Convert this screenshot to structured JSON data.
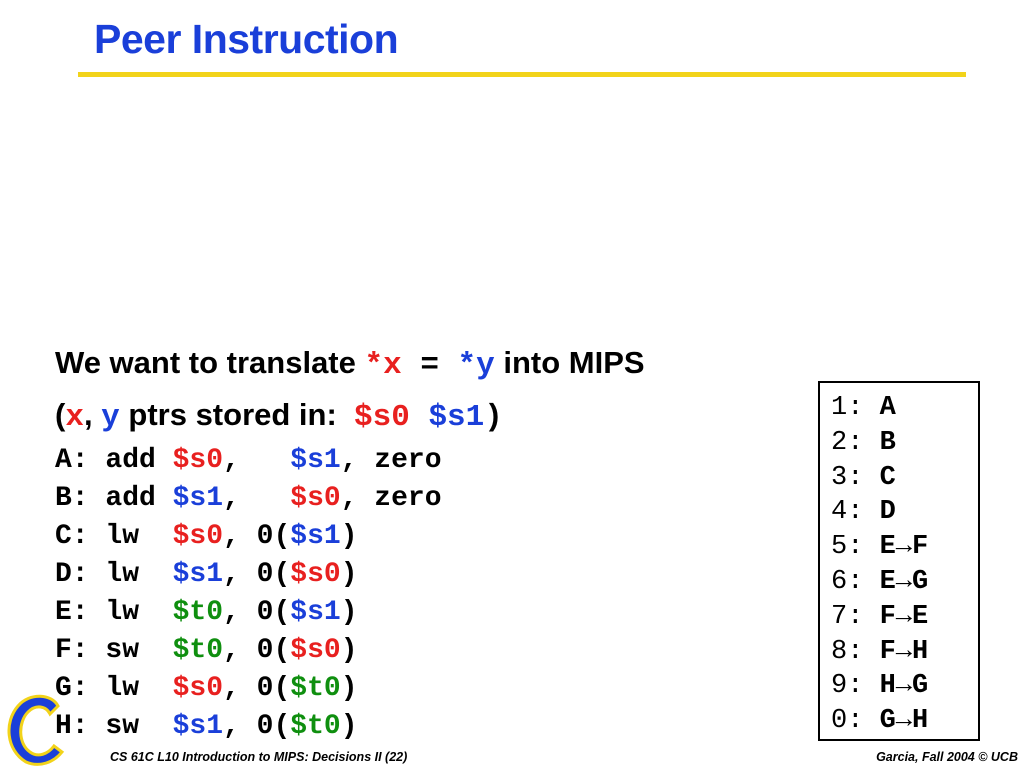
{
  "title": "Peer Instruction",
  "colors": {
    "title": "#1a3fd9",
    "rule": "#f2d31a",
    "red": "#e8201f",
    "blue": "#1a3fd9",
    "green": "#0f8f0f"
  },
  "intro": {
    "line1": {
      "text_a": "We want to translate ",
      "ptr_x": "*x",
      "eq": " = ",
      "ptr_y": "*y",
      "text_b": " into MIPS"
    },
    "line2": {
      "open": "(",
      "x": "x",
      "comma": ", ",
      "y": "y",
      "mid": " ptrs stored in:  ",
      "reg_a": "$s0",
      "sp": " ",
      "reg_b": "$s1",
      "close": ")"
    }
  },
  "code": [
    {
      "label": "A: add ",
      "r1": "$s0",
      "c1": ",   ",
      "r2": "$s1",
      "tail": ", zero"
    },
    {
      "label": "B: add ",
      "r1": "$s1",
      "c1": ",   ",
      "r2": "$s0",
      "tail": ", zero"
    },
    {
      "label": "C: lw  ",
      "r1": "$s0",
      "c1": ", 0(",
      "r2": "$s1",
      "tail": ")"
    },
    {
      "label": "D: lw  ",
      "r1": "$s1",
      "c1": ", 0(",
      "r2": "$s0",
      "tail": ")"
    },
    {
      "label": "E: lw  ",
      "r1": "$t0",
      "c1": ", 0(",
      "r2": "$s1",
      "tail": ")"
    },
    {
      "label": "F: sw  ",
      "r1": "$t0",
      "c1": ", 0(",
      "r2": "$s0",
      "tail": ")"
    },
    {
      "label": "G: lw  ",
      "r1": "$s0",
      "c1": ", 0(",
      "r2": "$t0",
      "tail": ")"
    },
    {
      "label": "H: sw  ",
      "r1": "$s1",
      "c1": ", 0(",
      "r2": "$t0",
      "tail": ")"
    }
  ],
  "answers": [
    {
      "key": "1: ",
      "value": "A"
    },
    {
      "key": "2: ",
      "value": "B"
    },
    {
      "key": "3: ",
      "value": "C"
    },
    {
      "key": "4: ",
      "value": "D"
    },
    {
      "key": "5: ",
      "value": "E→F"
    },
    {
      "key": "6: ",
      "value": "E→G"
    },
    {
      "key": "7: ",
      "value": "F→E"
    },
    {
      "key": "8: ",
      "value": "F→H"
    },
    {
      "key": "9: ",
      "value": "H→G"
    },
    {
      "key": "0: ",
      "value": "G→H"
    }
  ],
  "footer": {
    "left": "CS 61C L10 Introduction to MIPS:  Decisions II (22)",
    "right": "Garcia, Fall 2004 © UCB"
  },
  "logo_icon": "cal-logo-icon"
}
